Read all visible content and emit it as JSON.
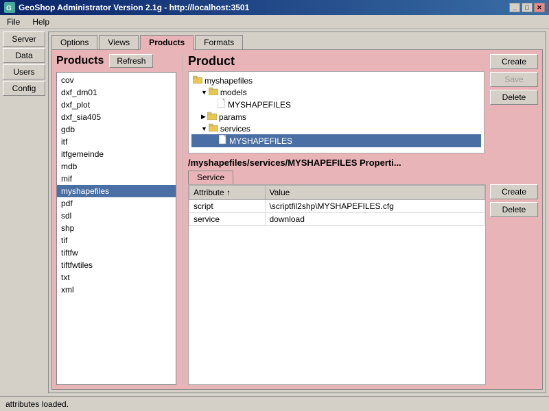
{
  "titlebar": {
    "title": "GeoShop Administrator Version 2.1g - http://localhost:3501",
    "icon": "G",
    "buttons": [
      "_",
      "□",
      "✕"
    ]
  },
  "menubar": {
    "items": [
      "File",
      "Help"
    ]
  },
  "sidebar": {
    "buttons": [
      "Server",
      "Data",
      "Users",
      "Config"
    ]
  },
  "tabs": {
    "items": [
      "Options",
      "Views",
      "Products",
      "Formats"
    ],
    "active": 2
  },
  "products": {
    "title": "Products",
    "refresh_label": "Refresh",
    "items": [
      "cov",
      "dxf_dm01",
      "dxf_plot",
      "dxf_sia405",
      "gdb",
      "itf",
      "itfgemeinde",
      "mdb",
      "mif",
      "myshapefiles",
      "pdf",
      "sdl",
      "shp",
      "tif",
      "tiftfw",
      "tiftfwtiles",
      "txt",
      "xml"
    ],
    "selected": "myshapefiles"
  },
  "product_section": {
    "heading": "Product",
    "buttons": {
      "create": "Create",
      "save": "Save",
      "delete": "Delete"
    },
    "tree": [
      {
        "label": "myshapefiles",
        "level": 0,
        "type": "folder",
        "expanded": true
      },
      {
        "label": "models",
        "level": 1,
        "type": "folder",
        "expanded": true
      },
      {
        "label": "MYSHAPEFILES",
        "level": 2,
        "type": "file"
      },
      {
        "label": "params",
        "level": 1,
        "type": "folder",
        "expanded": false
      },
      {
        "label": "services",
        "level": 1,
        "type": "folder",
        "expanded": true
      },
      {
        "label": "MYSHAPEFILES",
        "level": 2,
        "type": "file",
        "selected": true
      }
    ]
  },
  "properties": {
    "path": "/myshapefiles/services/MYSHAPEFILES Properti...",
    "service_tab": "Service",
    "table": {
      "columns": [
        "Attribute ↑",
        "Value"
      ],
      "rows": [
        {
          "attribute": "script",
          "value": "\\scriptfil2shp\\MYSHAPEFILES.cfg"
        },
        {
          "attribute": "service",
          "value": "download"
        }
      ]
    },
    "buttons": {
      "create": "Create",
      "delete": "Delete"
    }
  },
  "statusbar": {
    "text": "attributes loaded."
  }
}
